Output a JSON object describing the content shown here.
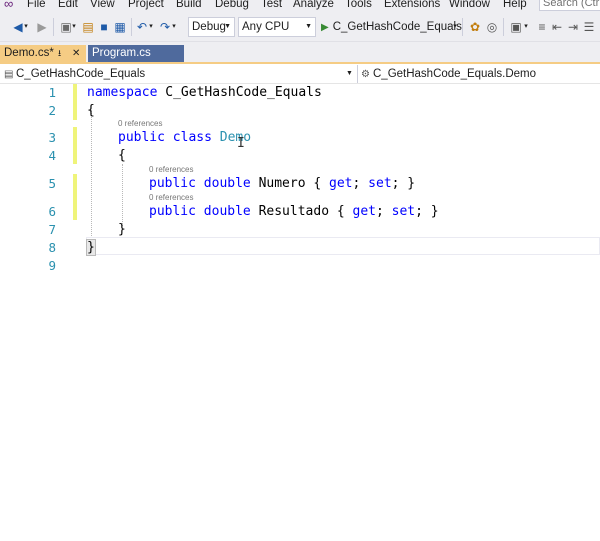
{
  "menubar": {
    "items": [
      "File",
      "Edit",
      "View",
      "Project",
      "Build",
      "Debug",
      "Test",
      "Analyze",
      "Tools",
      "Extensions",
      "Window",
      "Help"
    ],
    "search_placeholder": "Search (Ctrl+Q)"
  },
  "toolbar": {
    "configuration": "Debug",
    "platform": "Any CPU",
    "run_target": "C_GetHashCode_Equals"
  },
  "tabs": [
    {
      "label": "Demo.cs*",
      "active": true
    },
    {
      "label": "Program.cs",
      "active": false
    }
  ],
  "navbar": {
    "project": "C_GetHashCode_Equals",
    "type": "C_GetHashCode_Equals.Demo"
  },
  "editor": {
    "line_numbers": [
      "1",
      "2",
      "3",
      "4",
      "5",
      "6",
      "7",
      "8",
      "9"
    ],
    "lines": {
      "l1_kw": "namespace",
      "l1_name": " C_GetHashCode_Equals",
      "l2": "{",
      "l3_kw": "public class",
      "l3_type": "Demo",
      "l4": "{",
      "l5_kw": "public double",
      "l5_rest": " Numero { ",
      "l5_get": "get",
      "l5_mid": "; ",
      "l5_set": "set",
      "l5_end": "; }",
      "l6_kw": "public double",
      "l6_rest": " Resultado { ",
      "l6_get": "get",
      "l6_mid": "; ",
      "l6_set": "set",
      "l6_end": "; }",
      "l7": "}",
      "l8": "}"
    },
    "codelens": {
      "class": "0 references",
      "numero": "0 references",
      "resultado": "0 references"
    }
  },
  "colors": {
    "keyword": "#0000ff",
    "type": "#2b91af",
    "line_number": "#2b91af",
    "active_tab": "#f5cc84",
    "inactive_tab": "#4f6a9d",
    "change_bar": "#eff47a",
    "chrome": "#eeeef2"
  }
}
